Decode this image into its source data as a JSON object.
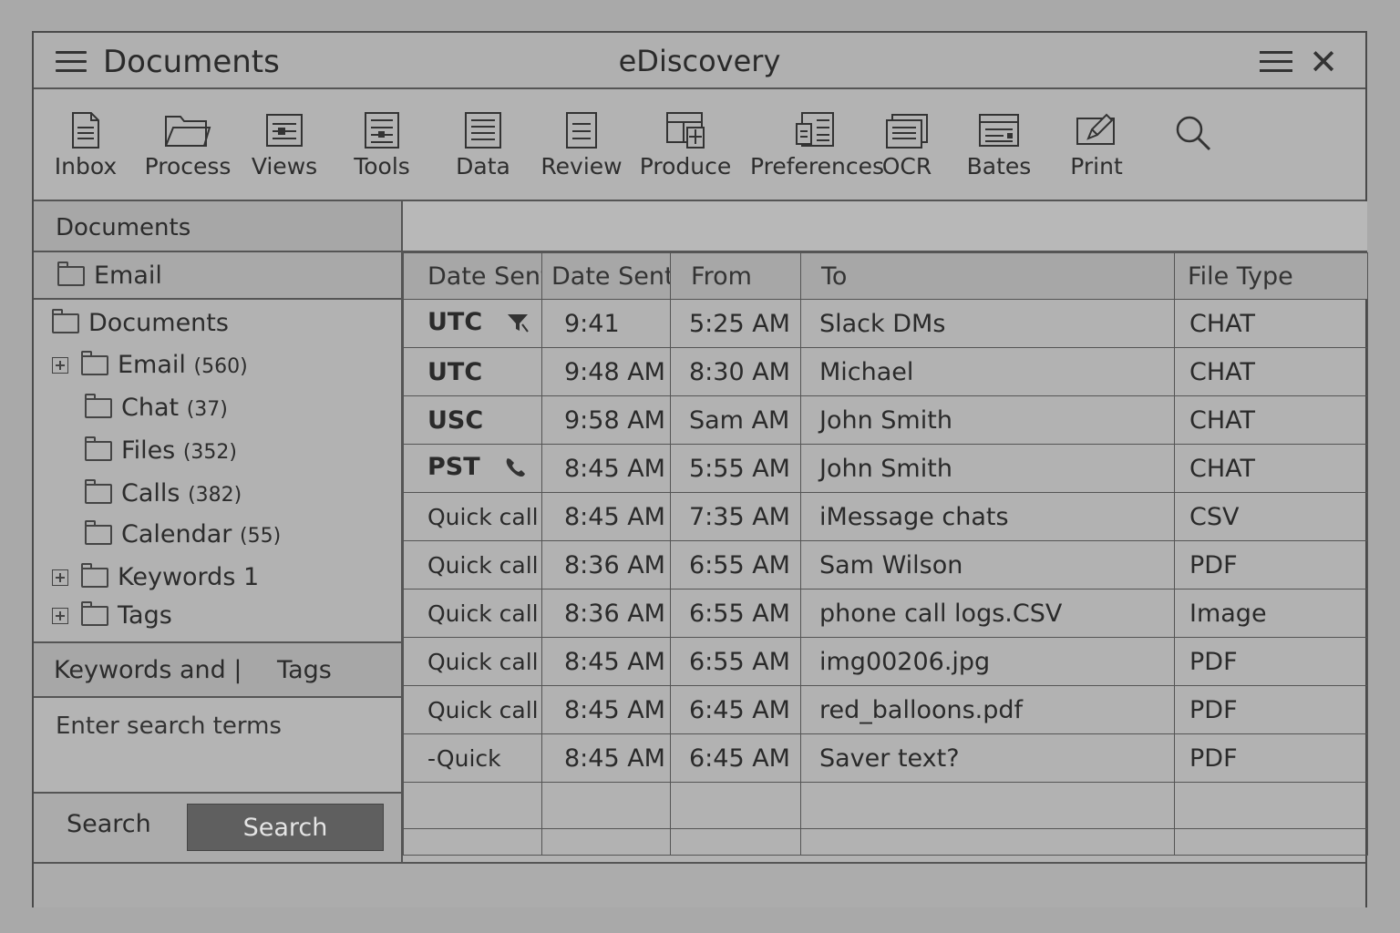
{
  "titlebar": {
    "left_title": "Documents",
    "center_title": "eDiscovery"
  },
  "toolbar": {
    "items": [
      {
        "label": "Inbox",
        "icon": "document-icon"
      },
      {
        "label": "Process",
        "icon": "folder-open-icon"
      },
      {
        "label": "Views",
        "icon": "views-icon"
      },
      {
        "label": "Tools",
        "icon": "tools-icon"
      },
      {
        "label": "Data",
        "icon": "data-icon"
      },
      {
        "label": "Review",
        "icon": "review-icon"
      },
      {
        "label": "Produce",
        "icon": "produce-icon"
      },
      {
        "label": "Preferences",
        "icon": "preferences-icon"
      },
      {
        "label": "OCR",
        "icon": "ocr-icon"
      },
      {
        "label": "Bates",
        "icon": "bates-icon"
      },
      {
        "label": "Print",
        "icon": "print-icon"
      },
      {
        "label": "",
        "icon": "search-icon"
      }
    ]
  },
  "sidebar": {
    "header": "Documents",
    "email_folder": "Email",
    "tree": [
      {
        "label": "Documents",
        "count": ""
      },
      {
        "label": "Email",
        "count": "(560)"
      },
      {
        "label": "Chat",
        "count": "(37)"
      },
      {
        "label": "Files",
        "count": "(352)"
      },
      {
        "label": "Calls",
        "count": "(382)"
      },
      {
        "label": "Calendar",
        "count": "(55)"
      },
      {
        "label": "Keywords 1",
        "count": ""
      },
      {
        "label": "Tags",
        "count": ""
      }
    ],
    "keywords_tab": "Keywords and |",
    "tags_tab": "Tags",
    "search_placeholder": "Enter search terms",
    "search_label": "Search",
    "search_button": "Search"
  },
  "table": {
    "columns": [
      "Date Sent",
      "Date Sent",
      "From",
      "To",
      "File Type"
    ],
    "rows": [
      {
        "c0": "UTC",
        "c1": "9:41",
        "c2": "5:25 AM",
        "c3": "Slack DMs",
        "c4": "CHAT",
        "icon": "filter-icon"
      },
      {
        "c0": "UTC",
        "c1": "9:48 AM",
        "c2": "8:30 AM",
        "c3": "Michael",
        "c4": "CHAT",
        "icon": ""
      },
      {
        "c0": "USC",
        "c1": "9:58 AM",
        "c2": "Sam AM",
        "c3": "John Smith",
        "c4": "CHAT",
        "icon": ""
      },
      {
        "c0": "PST",
        "c1": "8:45 AM",
        "c2": "5:55 AM",
        "c3": "John Smith",
        "c4": "CHAT",
        "icon": "phone-icon"
      },
      {
        "c0": "Quick call",
        "c1": "8:45 AM",
        "c2": "7:35 AM",
        "c3": "iMessage chats",
        "c4": "CSV",
        "icon": ""
      },
      {
        "c0": "Quick call",
        "c1": "8:36 AM",
        "c2": "6:55 AM",
        "c3": "Sam Wilson",
        "c4": "PDF",
        "icon": ""
      },
      {
        "c0": "Quick call",
        "c1": "8:36 AM",
        "c2": "6:55 AM",
        "c3": "phone call logs.CSV",
        "c4": "Image",
        "icon": ""
      },
      {
        "c0": "Quick call",
        "c1": "8:45 AM",
        "c2": "6:55 AM",
        "c3": "img00206.jpg",
        "c4": "PDF",
        "icon": ""
      },
      {
        "c0": "Quick call",
        "c1": "8:45 AM",
        "c2": "6:45 AM",
        "c3": "red_balloons.pdf",
        "c4": "PDF",
        "icon": ""
      },
      {
        "c0": "-Quick",
        "c1": "8:45 AM",
        "c2": "6:45 AM",
        "c3": "Saver text?",
        "c4": "PDF",
        "icon": ""
      }
    ]
  }
}
